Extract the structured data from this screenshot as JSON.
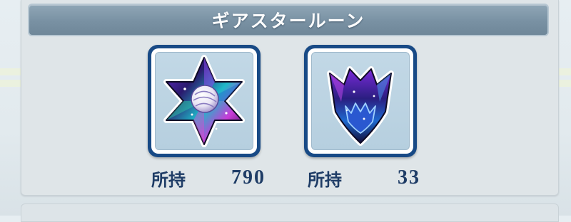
{
  "header": {
    "title": "ギアスタールーン"
  },
  "items": [
    {
      "icon": "star-rune-icon",
      "label": "所持",
      "count": "790"
    },
    {
      "icon": "crown-rune-icon",
      "label": "所持",
      "count": "33"
    }
  ],
  "colors": {
    "title_bar": "#7991a3",
    "card_border": "#184a86",
    "count_text": "#1e3c66"
  }
}
